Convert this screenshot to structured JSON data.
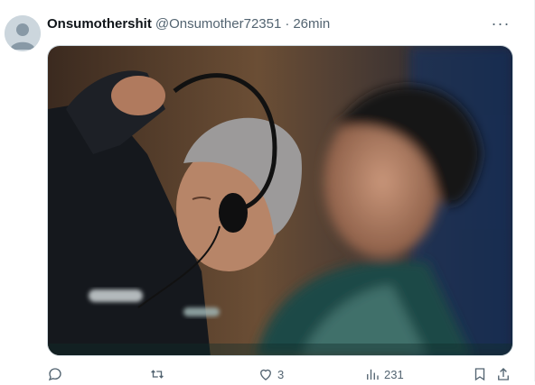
{
  "tweet": {
    "display_name": "Onsumothershit",
    "handle": "@Onsumother72351",
    "separator": "·",
    "time": "26min",
    "more_label": "···"
  },
  "actions": {
    "reply_count": "",
    "retweet_count": "",
    "like_count": "3",
    "views_count": "231"
  },
  "icons": {
    "avatar": "default-avatar-icon",
    "more": "more-options-icon",
    "reply": "reply-icon",
    "retweet": "retweet-icon",
    "like": "heart-icon",
    "views": "views-chart-icon",
    "bookmark": "bookmark-icon",
    "share": "share-icon"
  },
  "colors": {
    "text_primary": "#0f1419",
    "text_secondary": "#536471",
    "border": "#cfd9de"
  }
}
